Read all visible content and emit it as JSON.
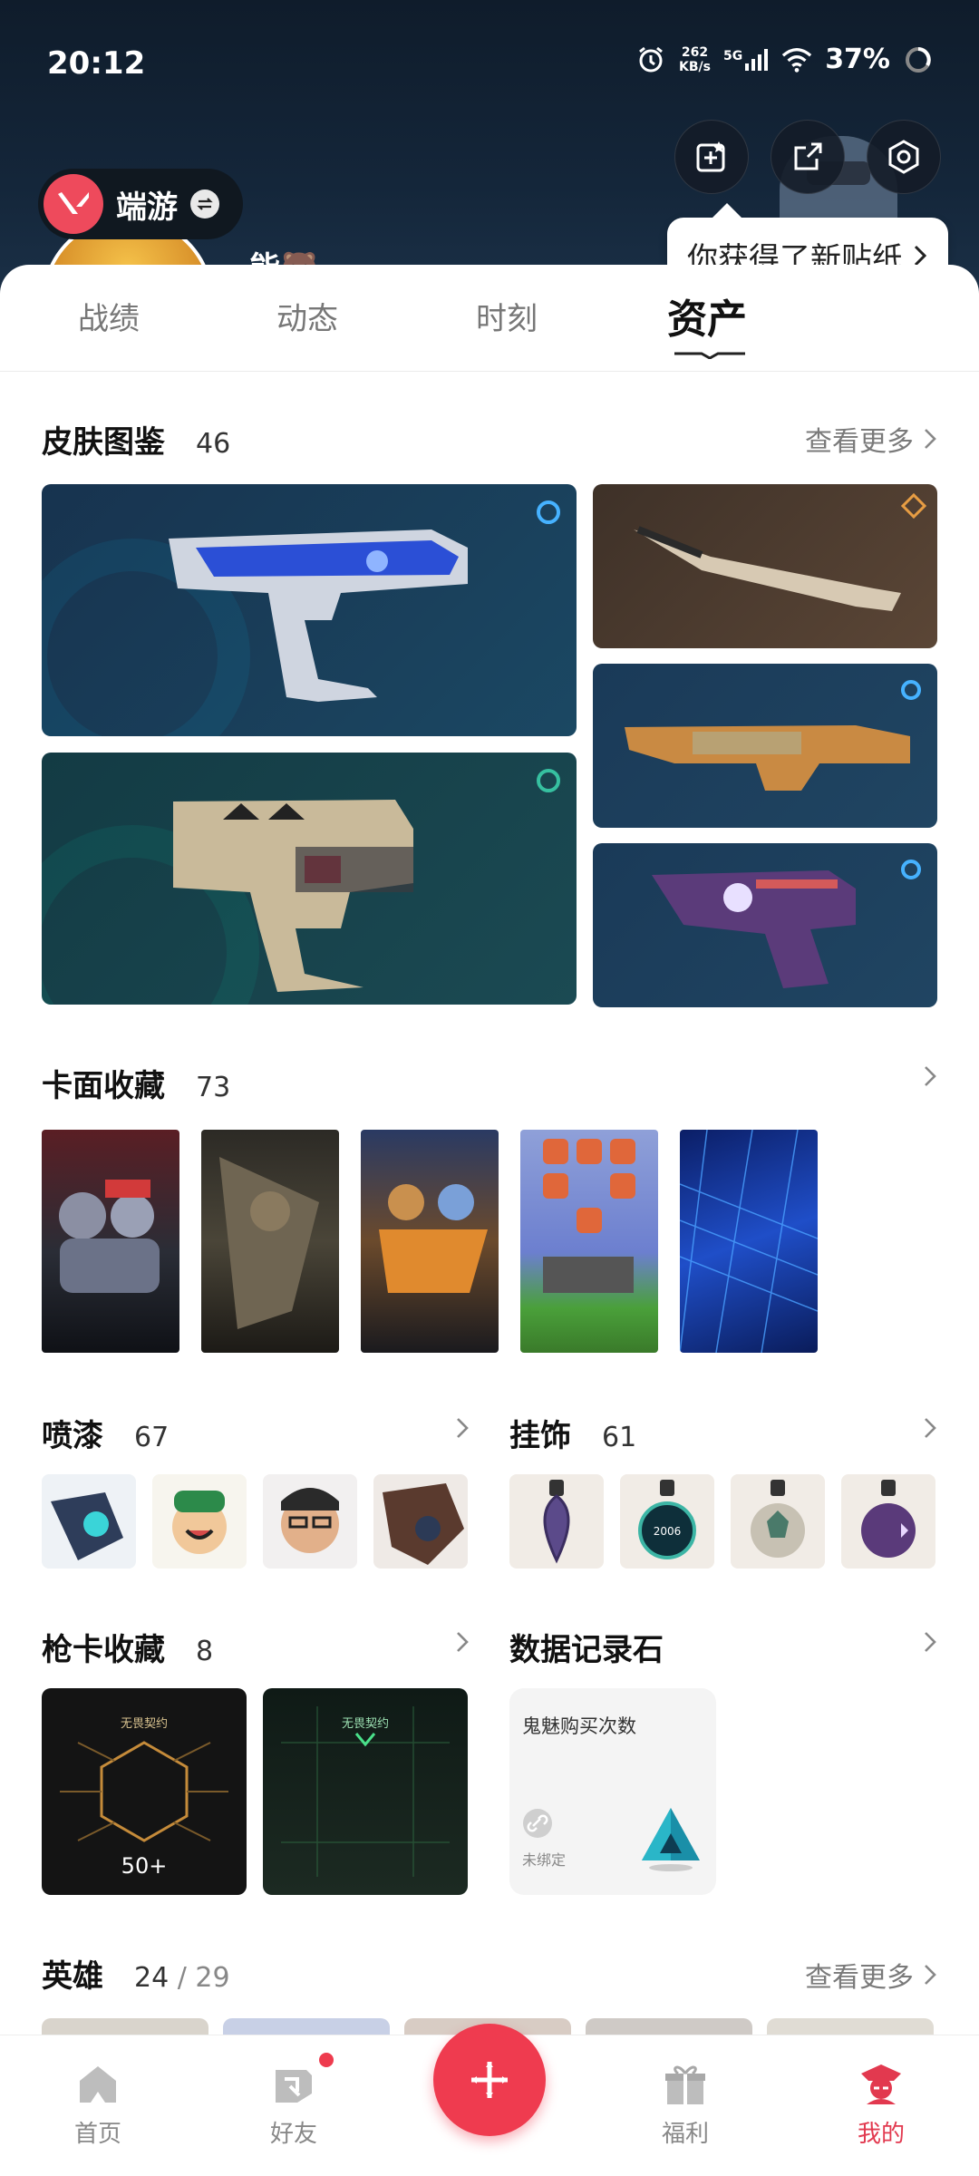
{
  "status_bar": {
    "time": "20:12",
    "speed_value": "262",
    "speed_unit": "KB/s",
    "network": "5G",
    "battery": "37%"
  },
  "header": {
    "brand_label": "端游",
    "nickname": "能🐻",
    "sticker_tip": "你获得了新贴纸",
    "icons": [
      "sticker-edit-icon",
      "share-icon",
      "settings-icon"
    ]
  },
  "tabs": [
    {
      "label": "战绩",
      "active": false
    },
    {
      "label": "动态",
      "active": false
    },
    {
      "label": "时刻",
      "active": false
    },
    {
      "label": "资产",
      "active": true
    }
  ],
  "skins": {
    "title": "皮肤图鉴",
    "count": "46",
    "more": "查看更多"
  },
  "cards": {
    "title": "卡面收藏",
    "count": "73"
  },
  "sprays": {
    "title": "喷漆",
    "count": "67"
  },
  "charms": {
    "title": "挂饰",
    "count": "61"
  },
  "gun_cards": {
    "title": "枪卡收藏",
    "count": "8",
    "items": [
      {
        "tag": "无畏契约",
        "num": "50+"
      },
      {
        "tag": "无畏契约",
        "num": ""
      }
    ]
  },
  "data_stone": {
    "title": "数据记录石",
    "item_title": "鬼魅购买次数",
    "item_status": "未绑定"
  },
  "agents": {
    "title": "英雄",
    "owned": "24",
    "total": "/ 29",
    "more": "查看更多"
  },
  "bottom_nav": [
    {
      "label": "首页",
      "icon": "home-icon"
    },
    {
      "label": "好友",
      "icon": "friends-icon"
    },
    {
      "label": "福利",
      "icon": "gift-icon"
    },
    {
      "label": "我的",
      "icon": "profile-icon"
    }
  ],
  "colors": {
    "accent": "#ef3b4f",
    "hero_bg": "#14263a"
  }
}
